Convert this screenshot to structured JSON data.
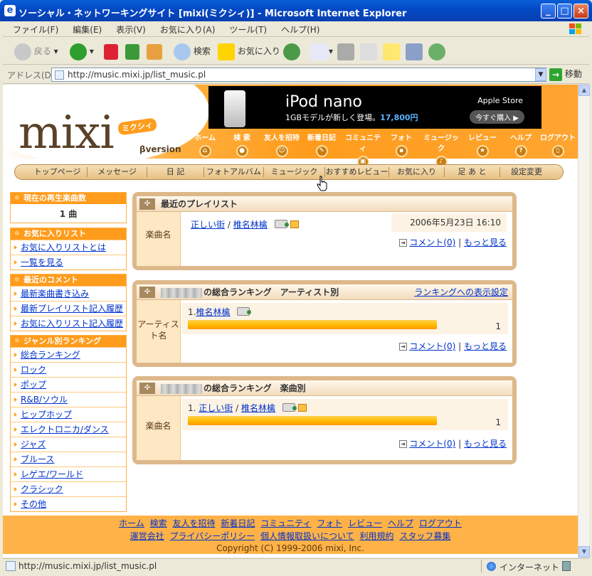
{
  "window": {
    "title": "ソーシャル・ネットワーキングサイト [mixi(ミクシィ)] - Microsoft Internet Explorer"
  },
  "menu": [
    "ファイル(F)",
    "編集(E)",
    "表示(V)",
    "お気に入り(A)",
    "ツール(T)",
    "ヘルプ(H)"
  ],
  "toolbar": {
    "back_label": "戻る",
    "search_label": "検索",
    "favorites_label": "お気に入り"
  },
  "address": {
    "label": "アドレス(D)",
    "url": "http://music.mixi.jp/list_music.pl",
    "go_label": "移動"
  },
  "header": {
    "logo": "mixi",
    "logo_kana": "ミクシィ",
    "beta": "βversion",
    "banner": {
      "title": "iPod nano",
      "subtitle": "1GBモデルが新しく登場。",
      "price": "17,800円",
      "store": "Apple Store",
      "buy": "今すぐ購入"
    },
    "nav": [
      "ホーム",
      "検 索",
      "友人を招待",
      "新着日記",
      "コミュニティ",
      "フォト",
      "ミュージック",
      "レビュー",
      "ヘルプ",
      "ログアウト"
    ]
  },
  "subnav": [
    "トップページ",
    "メッセージ",
    "日 記",
    "フォトアルバム",
    "ミュージック",
    "おすすめレビュー",
    "お気に入り",
    "足 あ と",
    "設定変更"
  ],
  "sidebar": {
    "now_playing": {
      "title": "現在の再生楽曲数",
      "value": "1 曲"
    },
    "favorites": {
      "title": "お気に入りリスト",
      "items": [
        "お気に入りリストとは",
        "一覧を見る"
      ]
    },
    "recent_comments": {
      "title": "最近のコメント",
      "items": [
        "最新楽曲書き込み",
        "最新プレイリスト記入履歴",
        "お気に入りリスト記入履歴"
      ]
    },
    "genre_ranking": {
      "title": "ジャンル別ランキング",
      "items": [
        "総合ランキング",
        "ロック",
        "ポップ",
        "R&B/ソウル",
        "ヒップホップ",
        "エレクトロニカ/ダンス",
        "ジャズ",
        "ブルース",
        "レゲエ/ワールド",
        "クラシック",
        "その他"
      ]
    }
  },
  "playlist": {
    "title": "最近のプレイリスト",
    "label": "楽曲名",
    "song": "正しい街",
    "sep": "/",
    "artist": "椎名林檎",
    "date": "2006年5月23日 16:10",
    "comment_link": "コメント(0)",
    "pipe": "|",
    "more_link": "もっと見る"
  },
  "artist_ranking": {
    "title": "の総合ランキング　アーティスト別",
    "setting_link": "ランキングへの表示設定",
    "label": "アーティスト名",
    "rank": "1.",
    "artist": "椎名林檎",
    "count": "1",
    "level": 1.0,
    "comment_link": "コメント(0)",
    "pipe": "|",
    "more_link": "もっと見る"
  },
  "song_ranking": {
    "title": "の総合ランキング　楽曲別",
    "label": "楽曲名",
    "rank": "1.",
    "song": "正しい街",
    "sep": "/",
    "artist": "椎名林檎",
    "count": "1",
    "level": 1.0,
    "comment_link": "コメント(0)",
    "pipe": "|",
    "more_link": "もっと見る"
  },
  "footer": {
    "row1": [
      "ホーム",
      "検索",
      "友人を招待",
      "新着日記",
      "コミュニティ",
      "フォト",
      "レビュー",
      "ヘルプ",
      "ログアウト"
    ],
    "row2": [
      "運営会社",
      "プライバシーポリシー",
      "個人情報取扱いについて",
      "利用規約",
      "スタッフ募集"
    ],
    "copyright": "Copyright (C) 1999-2006 mixi, Inc."
  },
  "status": {
    "url": "http://music.mixi.jp/list_music.pl",
    "zone": "インターネット"
  },
  "colors": {
    "accent": "#ff9c1c",
    "link": "#0033cc",
    "panel_border": "#ddb88a"
  }
}
